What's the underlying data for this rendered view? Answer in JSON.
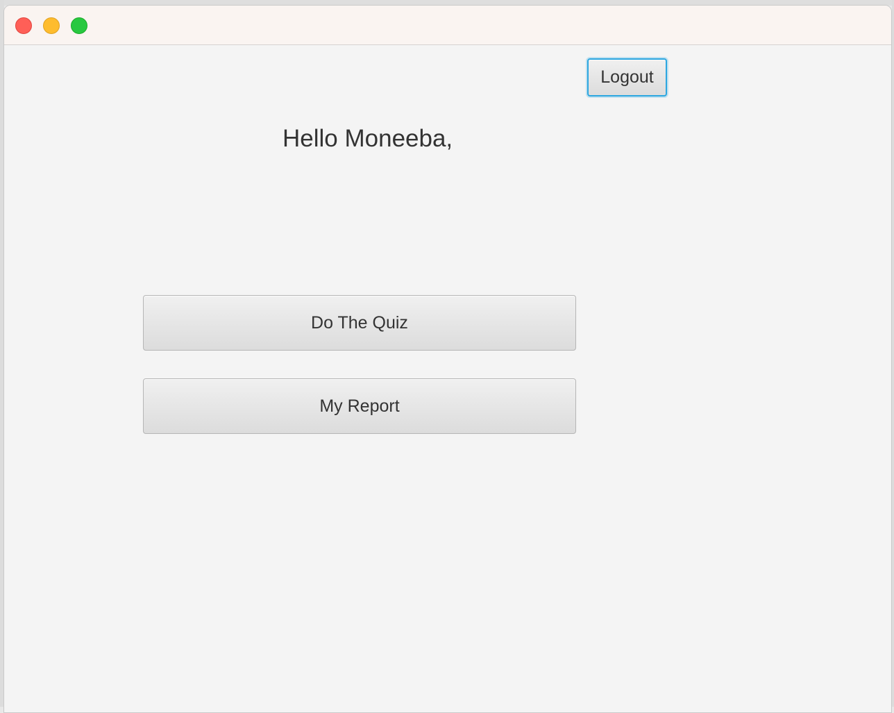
{
  "window": {
    "controls": [
      "close-icon",
      "minimize-icon",
      "maximize-icon"
    ]
  },
  "header": {
    "logout_label": "Logout"
  },
  "main": {
    "greeting": "Hello Moneeba,",
    "quiz_label": "Do The Quiz",
    "report_label": "My Report"
  },
  "colors": {
    "focus_ring": "#2ba6e0",
    "background": "#f4f4f4",
    "titlebar": "#faf4f1",
    "close": "#ff5f57",
    "minimize": "#febc2e",
    "maximize": "#28c840"
  }
}
